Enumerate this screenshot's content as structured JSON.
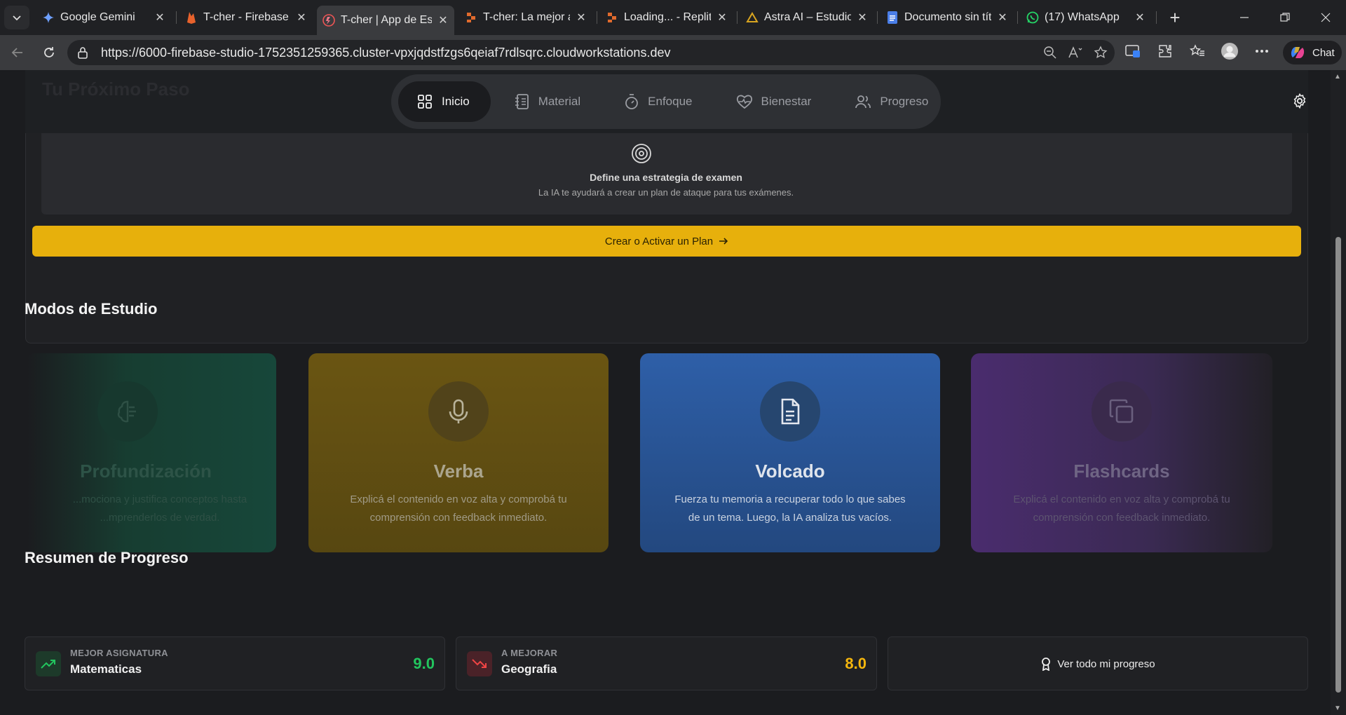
{
  "browser": {
    "tabs": [
      {
        "title": "Google Gemini",
        "icon": "gemini-icon",
        "active": false
      },
      {
        "title": "T-cher - Firebase St",
        "icon": "firebase-icon",
        "active": false
      },
      {
        "title": "T-cher | App de Estu",
        "icon": "tcher-icon",
        "active": true
      },
      {
        "title": "T-cher: La mejor ap",
        "icon": "replit-icon",
        "active": false
      },
      {
        "title": "Loading... - Replit",
        "icon": "replit-icon",
        "active": false
      },
      {
        "title": "Astra AI – Estudio y",
        "icon": "astra-icon",
        "active": false
      },
      {
        "title": "Documento sin títul",
        "icon": "docs-icon",
        "active": false
      },
      {
        "title": "(17) WhatsApp",
        "icon": "whatsapp-icon",
        "active": false
      }
    ],
    "url": "https://6000-firebase-studio-1752351259365.cluster-vpxjqdstfzgs6qeiaf7rdlsqrc.cloudworkstations.dev",
    "chat_label": "Chat"
  },
  "header": {
    "ghost_title": "Tu Próximo Paso",
    "nav": [
      {
        "label": "Inicio",
        "icon": "grid-icon",
        "active": true
      },
      {
        "label": "Material",
        "icon": "notebook-icon",
        "active": false
      },
      {
        "label": "Enfoque",
        "icon": "timer-icon",
        "active": false
      },
      {
        "label": "Bienestar",
        "icon": "heart-pulse-icon",
        "active": false
      },
      {
        "label": "Progreso",
        "icon": "users-icon",
        "active": false
      }
    ]
  },
  "plan": {
    "title": "Define una estrategia de examen",
    "subtitle": "La IA te ayudará a crear un plan de ataque para tus exámenes.",
    "button_label": "Crear o Activar un Plan"
  },
  "modes": {
    "section_title": "Modos de Estudio",
    "items": [
      {
        "title": "Profundización",
        "description": "...mociona y justifica conceptos hasta ...mprenderlos de verdad.",
        "icon": "brain-icon"
      },
      {
        "title": "Verba",
        "description": "Explicá el contenido en voz alta y comprobá tu comprensión con feedback inmediato.",
        "icon": "microphone-icon"
      },
      {
        "title": "Volcado",
        "description": "Fuerza tu memoria a recuperar todo lo que sabes de un tema. Luego, la IA analiza tus vacíos.",
        "icon": "document-icon"
      },
      {
        "title": "Flashcards",
        "description": "Explicá el contenido en voz alta y comprobá tu comprensión con feedback inmediato.",
        "icon": "copy-icon"
      }
    ]
  },
  "progress": {
    "section_title": "Resumen de Progreso",
    "best": {
      "label": "MEJOR ASIGNATURA",
      "subject": "Matematicas",
      "score": "9.0",
      "color": "#22c55e"
    },
    "improve": {
      "label": "A MEJORAR",
      "subject": "Geografia",
      "score": "8.0",
      "color": "#f5b60d"
    },
    "link_label": "Ver todo mi progreso"
  },
  "colors": {
    "accent": "#e7b00c",
    "background": "#1b1c1f"
  }
}
